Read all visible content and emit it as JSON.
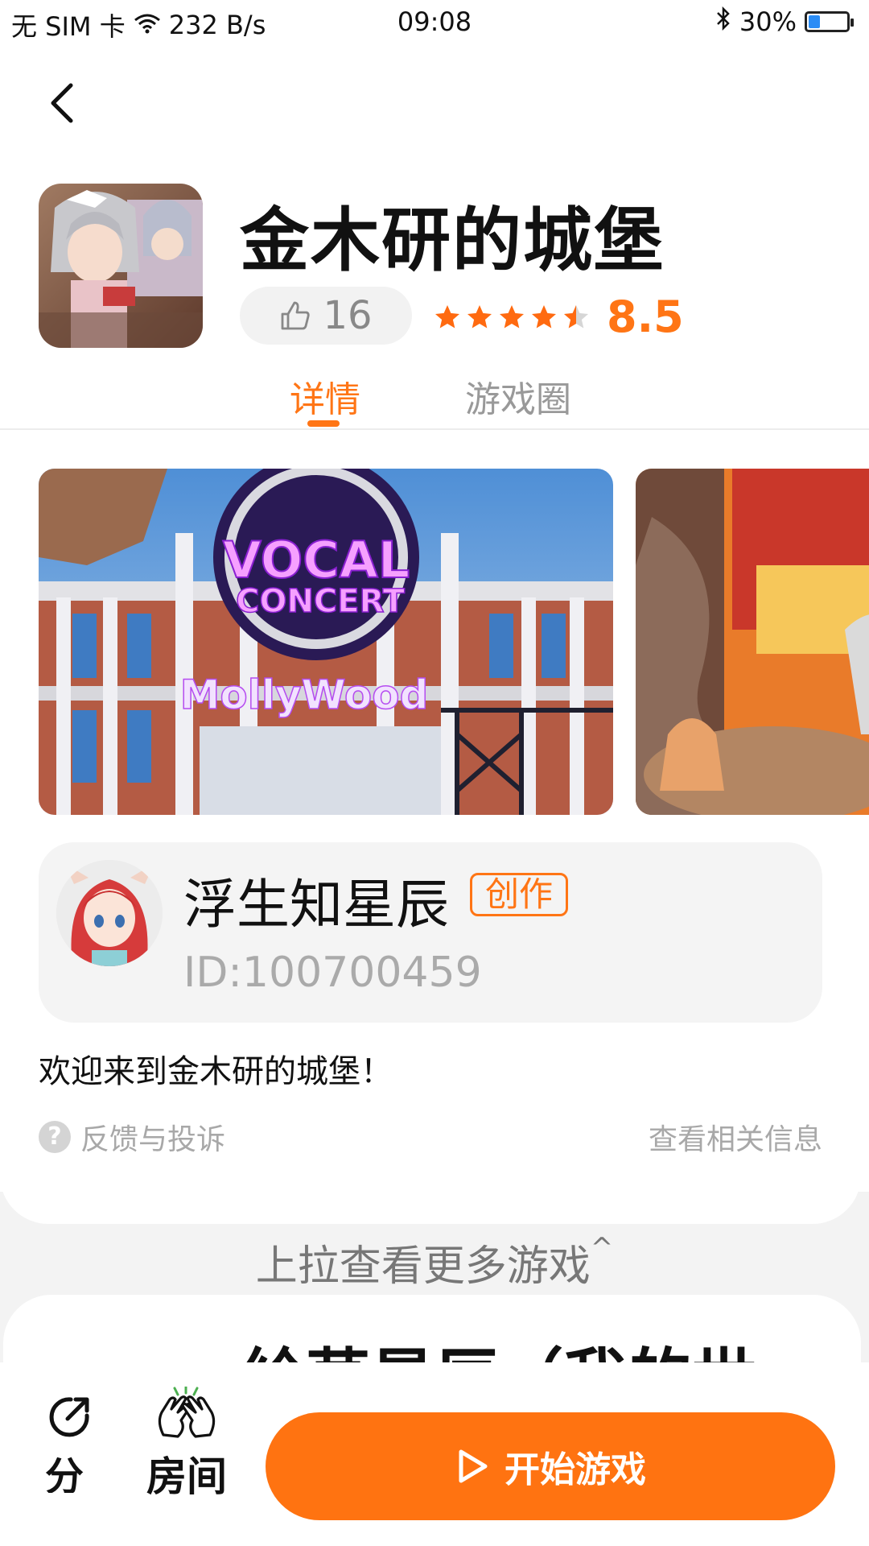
{
  "status_bar": {
    "carrier": "无 SIM 卡",
    "net_speed": "232 B/s",
    "time": "09:08",
    "battery_percent": "30%",
    "battery_level": 0.3
  },
  "header": {
    "back_icon": "chevron-left-icon"
  },
  "game": {
    "title": "金木研的城堡",
    "likes": "16",
    "rating_stars": 4.5,
    "score": "8.5"
  },
  "tabs": [
    {
      "label": "详情",
      "active": true
    },
    {
      "label": "游戏圈",
      "active": false
    }
  ],
  "screenshots": {
    "shot1_sign_line1": "VOCAL",
    "shot1_sign_line2": "CONCERT",
    "shot1_sign_line3": "MollyWood"
  },
  "creator": {
    "name": "浮生知星辰",
    "badge": "创作",
    "id": "ID:100700459"
  },
  "description": "欢迎来到金木研的城堡！",
  "links": {
    "feedback": "反馈与投诉",
    "related": "查看相关信息"
  },
  "more": {
    "pull_up": "上拉查看更多游戏",
    "next_game_title": "絵草星辰（我的世"
  },
  "bottom_bar": {
    "share": "分享",
    "room": "房间",
    "start": "开始游戏"
  },
  "colors": {
    "accent": "#ff7515",
    "button": "#ff7311",
    "battery": "#2a8cf5"
  }
}
